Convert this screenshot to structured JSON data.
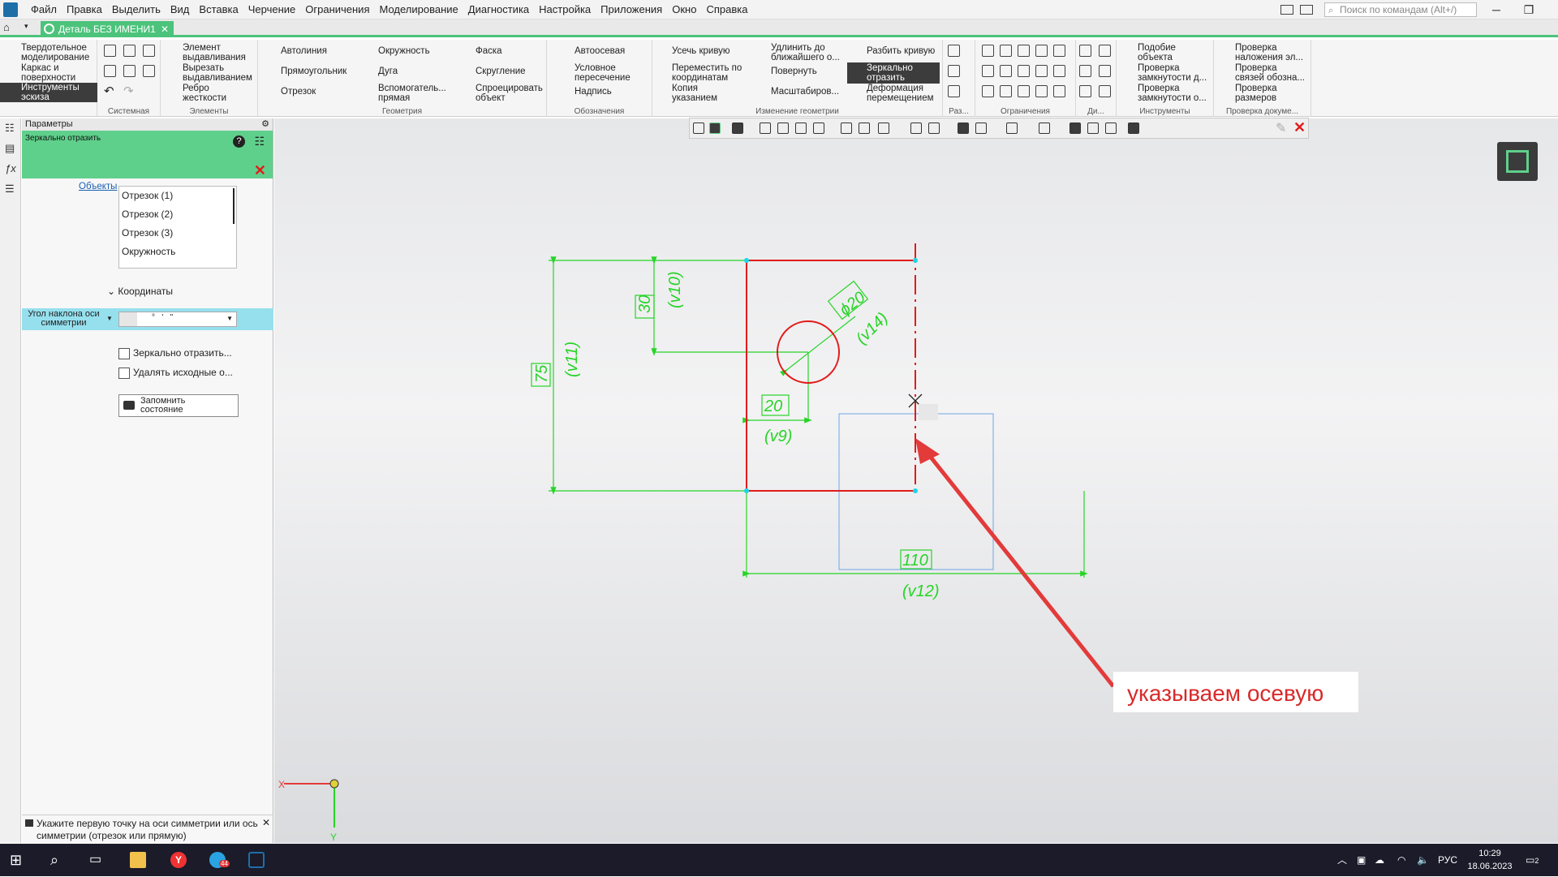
{
  "menu": [
    "Файл",
    "Правка",
    "Выделить",
    "Вид",
    "Вставка",
    "Черчение",
    "Ограничения",
    "Моделирование",
    "Диагностика",
    "Настройка",
    "Приложения",
    "Окно",
    "Справка"
  ],
  "search_placeholder": "Поиск по командам (Alt+/)",
  "doc_tab": "Деталь БЕЗ ИМЕНИ1",
  "ribbon": {
    "mode_buttons": [
      "Твердотельное\nмоделирование",
      "Каркас и\nповерхности",
      "Инструменты\nэскиза"
    ],
    "groups": [
      "Системная",
      "Элементы",
      "Геометрия",
      "Обозначения",
      "Изменение геометрии",
      "Раз...",
      "Ограничения",
      "Ди...",
      "Инструменты",
      "Проверка докуме..."
    ],
    "elements": [
      "Элемент\nвыдавливания",
      "Вырезать\nвыдавливанием",
      "Ребро\nжесткости"
    ],
    "geometry": [
      "Автолиния",
      "Окружность",
      "Фаска",
      "Прямоугольник",
      "Дуга",
      "Скругление",
      "Отрезок",
      "Вспомогатель...\nпрямая",
      "Спроецировать\nобъект"
    ],
    "annotations": [
      "Автоосевая",
      "Условное\nпересечение",
      "Надпись"
    ],
    "edit": [
      "Усечь кривую",
      "Удлинить до\nближайшего о...",
      "Разбить кривую",
      "Переместить по\nкоординатам",
      "Повернуть",
      "Зеркально\nотразить",
      "Копия\nуказанием",
      "Масштабиров...",
      "Деформация\nперемещением"
    ],
    "tools": [
      "Подобие\nобъекта",
      "Проверка\nзамкнутости д...",
      "Проверка\nзамкнутости о..."
    ],
    "check": [
      "Проверка\nналожения эл...",
      "Проверка\nсвязей обозна...",
      "Проверка\nразмеров"
    ]
  },
  "panel": {
    "title": "Параметры",
    "command": "Зеркально отразить",
    "objects_label": "Объекты",
    "objects": [
      "Отрезок (1)",
      "Отрезок (2)",
      "Отрезок (3)",
      "Окружность"
    ],
    "coords_label": "Координаты",
    "angle_label": "Угол наклона оси симметрии",
    "angle_value": "°   '   \"",
    "chk_mirror": "Зеркально отразить...",
    "chk_delete": "Удалять исходные о...",
    "save_state": "Запомнить\nсостояние",
    "hint": "Укажите первую точку на оси симметрии или ось симметрии (отрезок или прямую)"
  },
  "drawing": {
    "dims": {
      "d30": "30",
      "v10": "(v10)",
      "d75": "75",
      "v11": "(v11)",
      "d20": "20",
      "v9": "(v9)",
      "phi20": "ϕ20",
      "v14": "(v14)",
      "d110": "110",
      "v12": "(v12)"
    },
    "callout": "указываем осевую",
    "axis_x": "X",
    "axis_y": "Y"
  },
  "taskbar": {
    "lang": "РУС",
    "time": "10:29",
    "date": "18.06.2023",
    "notif": "2",
    "tg_badge": "44"
  }
}
